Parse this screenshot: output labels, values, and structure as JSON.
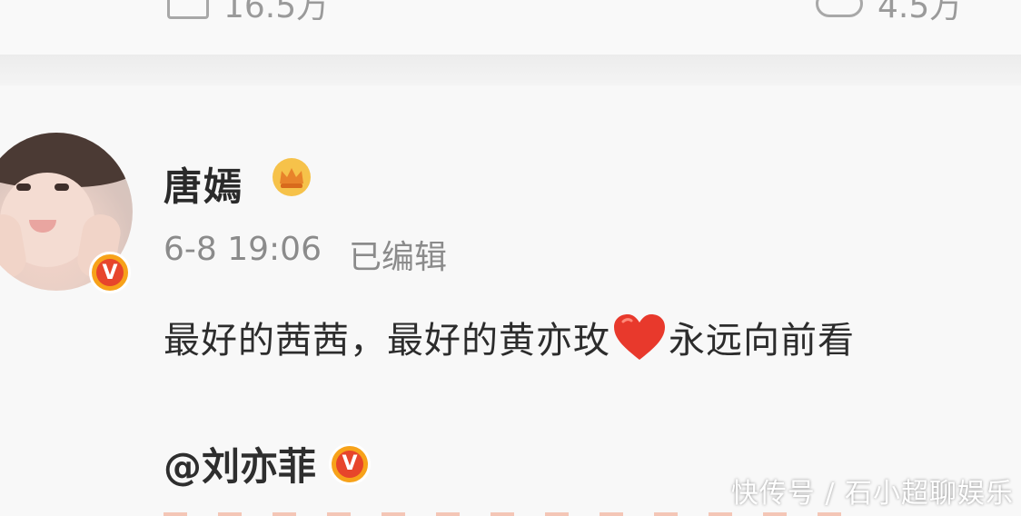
{
  "top_bar": {
    "left_count": "16.5万",
    "right_count": "4.5万",
    "left_icon": "repost-icon",
    "right_icon": "comment-icon"
  },
  "comment": {
    "username": "唐嫣",
    "crown_icon": "vip-crown-icon",
    "verified_symbol": "V",
    "timestamp": "6-8 19:06",
    "edited_label": "已编辑",
    "text_before_heart": "最好的茜茜，最好的黄亦玫",
    "heart_icon": "red-heart-icon",
    "text_after_heart": "永远向前看",
    "mention": "@刘亦菲",
    "mention_verified_symbol": "V"
  },
  "watermark": "快传号 / 石小超聊娱乐",
  "colors": {
    "background": "#f7f7f7",
    "username": "#2a2a2a",
    "meta_text": "#8b8b8b",
    "badge_orange": "#f7a21a",
    "badge_red": "#e7452b",
    "heart": "#e8392c"
  }
}
